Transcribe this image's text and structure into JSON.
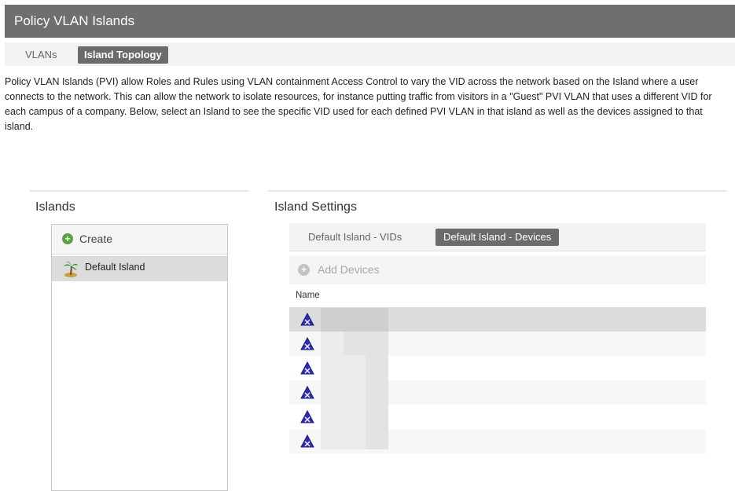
{
  "window": {
    "title": "Policy VLAN Islands"
  },
  "main_tabs": [
    {
      "label": "VLANs",
      "active": false
    },
    {
      "label": "Island Topology",
      "active": true
    }
  ],
  "description": "Policy VLAN Islands (PVI) allow Roles and Rules using VLAN containment Access Control to vary the VID across the network based on the Island where a user connects to the network. This can allow the network to isolate resources, for instance putting traffic from visitors in a \"Guest\" PVI VLAN that uses a different VID for each campus of a company. Below, select an Island to see the specific VID used for each defined PVI VLAN in that island as well as the devices assigned to that island.",
  "islands": {
    "heading": "Islands",
    "create_label": "Create",
    "items": [
      {
        "label": "Default Island",
        "selected": true,
        "icon": "palm-tree-icon"
      }
    ]
  },
  "island_settings": {
    "heading": "Island Settings",
    "tabs": [
      {
        "label": "Default Island - VIDs",
        "active": false
      },
      {
        "label": "Default Island - Devices",
        "active": true
      }
    ],
    "add_devices_label": "Add Devices",
    "column_name": "Name",
    "devices": [
      {
        "name": "",
        "icon": "device-icon",
        "selected": true
      },
      {
        "name": "",
        "icon": "device-icon",
        "selected": false
      },
      {
        "name": "",
        "icon": "device-icon",
        "selected": false
      },
      {
        "name": "",
        "icon": "device-icon",
        "selected": false
      },
      {
        "name": "",
        "icon": "device-icon",
        "selected": false
      },
      {
        "name": "",
        "icon": "device-icon",
        "selected": false
      }
    ]
  },
  "colors": {
    "titlebar": "#6f6f6f",
    "active_tab": "#6b6b6b",
    "create_plus": "#5aa33a",
    "device_icon": "#2d2db8"
  }
}
